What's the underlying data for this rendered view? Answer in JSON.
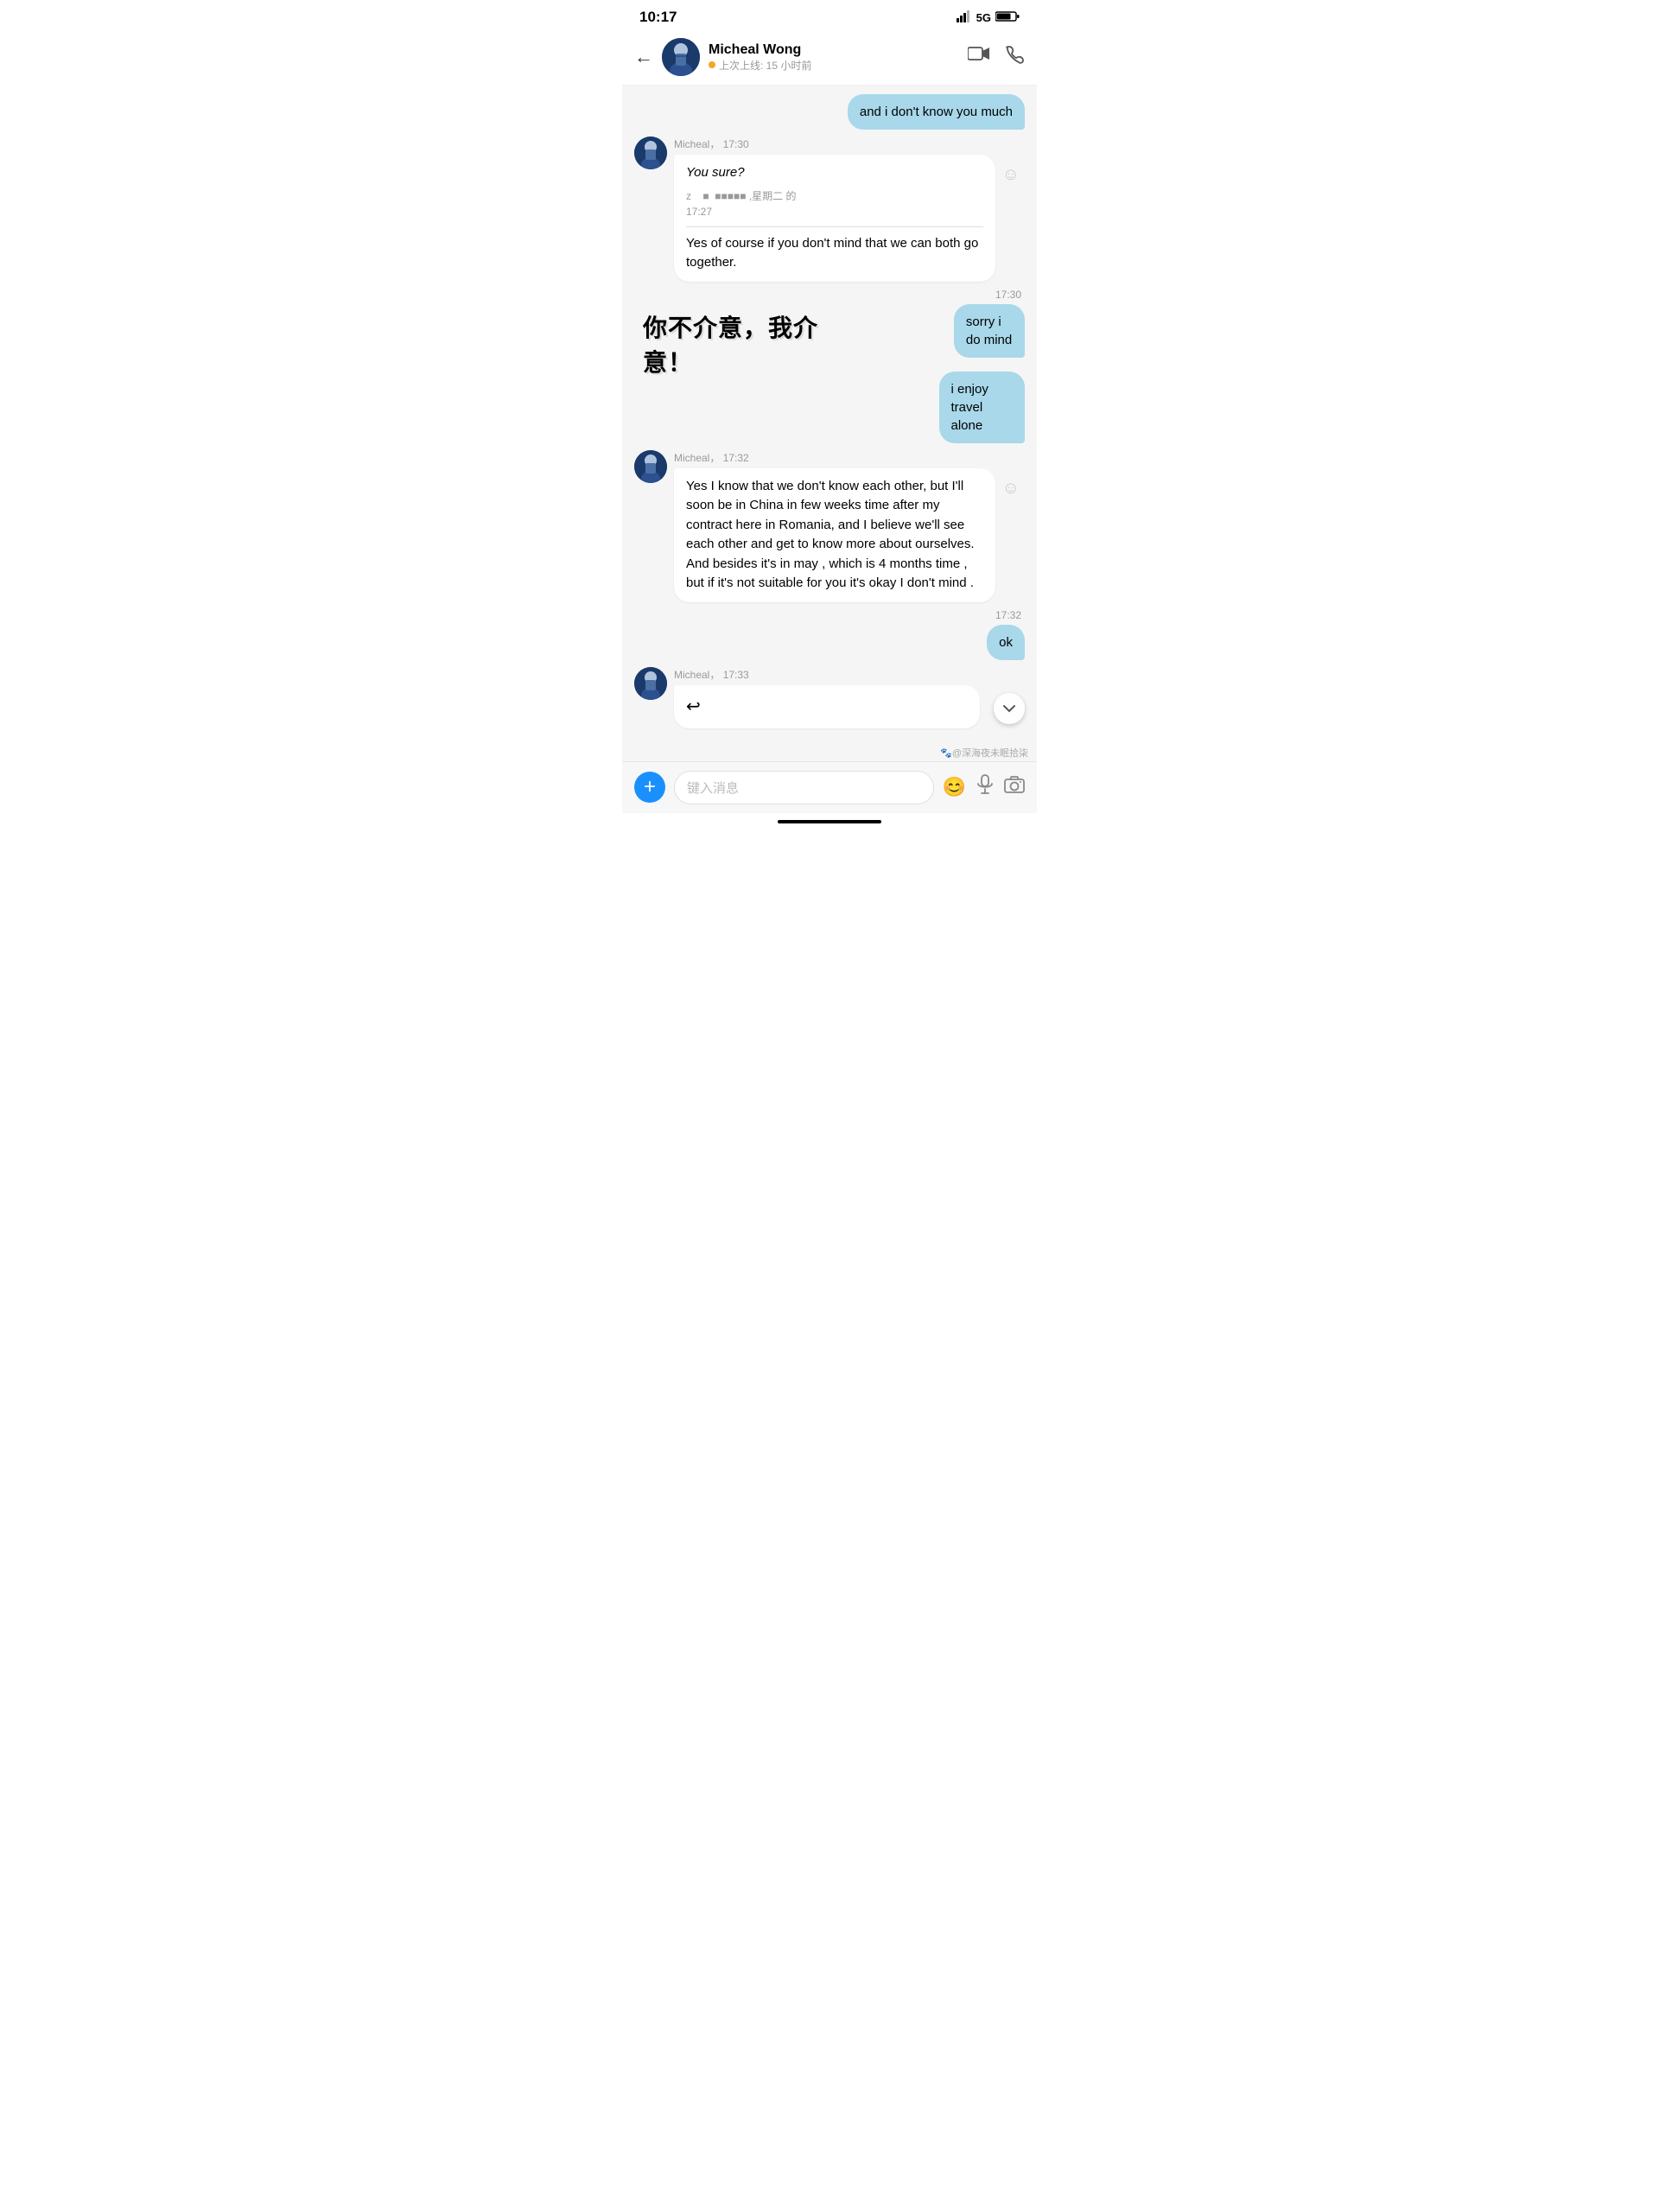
{
  "statusBar": {
    "time": "10:17",
    "network": "5G",
    "batteryIcon": "🔋"
  },
  "header": {
    "backLabel": "←",
    "contactName": "Micheal Wong",
    "lastSeen": "上次上线: 15 小时前",
    "videoCallIcon": "📹",
    "voiceCallIcon": "📞"
  },
  "messages": [
    {
      "type": "sent",
      "text": "and i don't know you much"
    },
    {
      "type": "received",
      "sender": "Micheal",
      "time": "17:30",
      "hasQuote": true,
      "quotedSender": "z",
      "quotedText": "■ ■■■■■ ,星期二 的 17:27",
      "italic": "You sure?",
      "body": "Yes of course if you don't mind that we can both go together."
    },
    {
      "type": "timestamp",
      "value": "17:30"
    },
    {
      "type": "sent",
      "text": "sorry i do mind"
    },
    {
      "type": "sent",
      "text": "i enjoy travel alone"
    },
    {
      "type": "received",
      "sender": "Micheal",
      "time": "17:32",
      "body": "Yes I know that we don't know each other, but I'll soon be in China in few weeks time after my contract here in Romania, and I believe we'll see each other and get to know more about ourselves. And besides it's in may , which is 4 months time , but if it's not suitable for you it's okay I don't mind ."
    },
    {
      "type": "timestamp",
      "value": "17:32"
    },
    {
      "type": "sent",
      "text": "ok"
    },
    {
      "type": "received",
      "sender": "Micheal",
      "time": "17:33",
      "body": "↩"
    }
  ],
  "overlayText": "你不介意，我介意！",
  "inputBar": {
    "placeholder": "键入消息",
    "addIcon": "+",
    "emojiIcon": "😊",
    "micIcon": "🎤",
    "cameraIcon": "📷"
  },
  "watermark": "🐾@深海夜未眠拾柒"
}
